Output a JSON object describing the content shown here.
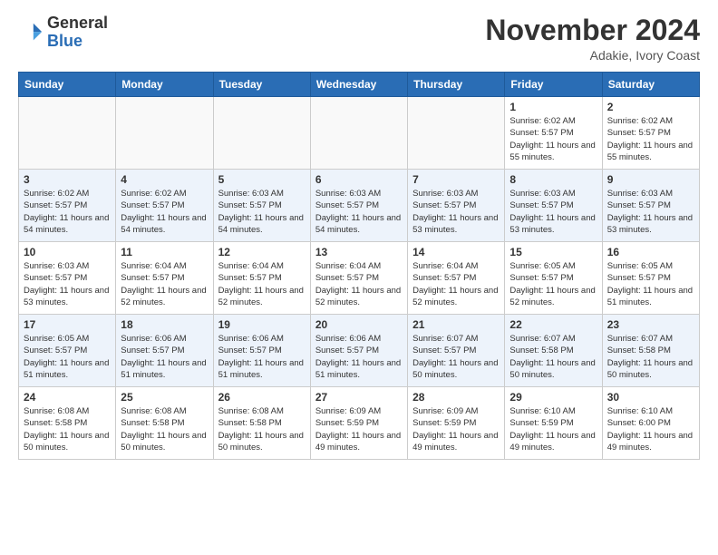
{
  "header": {
    "logo_general": "General",
    "logo_blue": "Blue",
    "month_title": "November 2024",
    "location": "Adakie, Ivory Coast"
  },
  "weekdays": [
    "Sunday",
    "Monday",
    "Tuesday",
    "Wednesday",
    "Thursday",
    "Friday",
    "Saturday"
  ],
  "weeks": [
    [
      {
        "day": "",
        "sunrise": "",
        "sunset": "",
        "daylight": ""
      },
      {
        "day": "",
        "sunrise": "",
        "sunset": "",
        "daylight": ""
      },
      {
        "day": "",
        "sunrise": "",
        "sunset": "",
        "daylight": ""
      },
      {
        "day": "",
        "sunrise": "",
        "sunset": "",
        "daylight": ""
      },
      {
        "day": "",
        "sunrise": "",
        "sunset": "",
        "daylight": ""
      },
      {
        "day": "1",
        "sunrise": "Sunrise: 6:02 AM",
        "sunset": "Sunset: 5:57 PM",
        "daylight": "Daylight: 11 hours and 55 minutes."
      },
      {
        "day": "2",
        "sunrise": "Sunrise: 6:02 AM",
        "sunset": "Sunset: 5:57 PM",
        "daylight": "Daylight: 11 hours and 55 minutes."
      }
    ],
    [
      {
        "day": "3",
        "sunrise": "Sunrise: 6:02 AM",
        "sunset": "Sunset: 5:57 PM",
        "daylight": "Daylight: 11 hours and 54 minutes."
      },
      {
        "day": "4",
        "sunrise": "Sunrise: 6:02 AM",
        "sunset": "Sunset: 5:57 PM",
        "daylight": "Daylight: 11 hours and 54 minutes."
      },
      {
        "day": "5",
        "sunrise": "Sunrise: 6:03 AM",
        "sunset": "Sunset: 5:57 PM",
        "daylight": "Daylight: 11 hours and 54 minutes."
      },
      {
        "day": "6",
        "sunrise": "Sunrise: 6:03 AM",
        "sunset": "Sunset: 5:57 PM",
        "daylight": "Daylight: 11 hours and 54 minutes."
      },
      {
        "day": "7",
        "sunrise": "Sunrise: 6:03 AM",
        "sunset": "Sunset: 5:57 PM",
        "daylight": "Daylight: 11 hours and 53 minutes."
      },
      {
        "day": "8",
        "sunrise": "Sunrise: 6:03 AM",
        "sunset": "Sunset: 5:57 PM",
        "daylight": "Daylight: 11 hours and 53 minutes."
      },
      {
        "day": "9",
        "sunrise": "Sunrise: 6:03 AM",
        "sunset": "Sunset: 5:57 PM",
        "daylight": "Daylight: 11 hours and 53 minutes."
      }
    ],
    [
      {
        "day": "10",
        "sunrise": "Sunrise: 6:03 AM",
        "sunset": "Sunset: 5:57 PM",
        "daylight": "Daylight: 11 hours and 53 minutes."
      },
      {
        "day": "11",
        "sunrise": "Sunrise: 6:04 AM",
        "sunset": "Sunset: 5:57 PM",
        "daylight": "Daylight: 11 hours and 52 minutes."
      },
      {
        "day": "12",
        "sunrise": "Sunrise: 6:04 AM",
        "sunset": "Sunset: 5:57 PM",
        "daylight": "Daylight: 11 hours and 52 minutes."
      },
      {
        "day": "13",
        "sunrise": "Sunrise: 6:04 AM",
        "sunset": "Sunset: 5:57 PM",
        "daylight": "Daylight: 11 hours and 52 minutes."
      },
      {
        "day": "14",
        "sunrise": "Sunrise: 6:04 AM",
        "sunset": "Sunset: 5:57 PM",
        "daylight": "Daylight: 11 hours and 52 minutes."
      },
      {
        "day": "15",
        "sunrise": "Sunrise: 6:05 AM",
        "sunset": "Sunset: 5:57 PM",
        "daylight": "Daylight: 11 hours and 52 minutes."
      },
      {
        "day": "16",
        "sunrise": "Sunrise: 6:05 AM",
        "sunset": "Sunset: 5:57 PM",
        "daylight": "Daylight: 11 hours and 51 minutes."
      }
    ],
    [
      {
        "day": "17",
        "sunrise": "Sunrise: 6:05 AM",
        "sunset": "Sunset: 5:57 PM",
        "daylight": "Daylight: 11 hours and 51 minutes."
      },
      {
        "day": "18",
        "sunrise": "Sunrise: 6:06 AM",
        "sunset": "Sunset: 5:57 PM",
        "daylight": "Daylight: 11 hours and 51 minutes."
      },
      {
        "day": "19",
        "sunrise": "Sunrise: 6:06 AM",
        "sunset": "Sunset: 5:57 PM",
        "daylight": "Daylight: 11 hours and 51 minutes."
      },
      {
        "day": "20",
        "sunrise": "Sunrise: 6:06 AM",
        "sunset": "Sunset: 5:57 PM",
        "daylight": "Daylight: 11 hours and 51 minutes."
      },
      {
        "day": "21",
        "sunrise": "Sunrise: 6:07 AM",
        "sunset": "Sunset: 5:57 PM",
        "daylight": "Daylight: 11 hours and 50 minutes."
      },
      {
        "day": "22",
        "sunrise": "Sunrise: 6:07 AM",
        "sunset": "Sunset: 5:58 PM",
        "daylight": "Daylight: 11 hours and 50 minutes."
      },
      {
        "day": "23",
        "sunrise": "Sunrise: 6:07 AM",
        "sunset": "Sunset: 5:58 PM",
        "daylight": "Daylight: 11 hours and 50 minutes."
      }
    ],
    [
      {
        "day": "24",
        "sunrise": "Sunrise: 6:08 AM",
        "sunset": "Sunset: 5:58 PM",
        "daylight": "Daylight: 11 hours and 50 minutes."
      },
      {
        "day": "25",
        "sunrise": "Sunrise: 6:08 AM",
        "sunset": "Sunset: 5:58 PM",
        "daylight": "Daylight: 11 hours and 50 minutes."
      },
      {
        "day": "26",
        "sunrise": "Sunrise: 6:08 AM",
        "sunset": "Sunset: 5:58 PM",
        "daylight": "Daylight: 11 hours and 50 minutes."
      },
      {
        "day": "27",
        "sunrise": "Sunrise: 6:09 AM",
        "sunset": "Sunset: 5:59 PM",
        "daylight": "Daylight: 11 hours and 49 minutes."
      },
      {
        "day": "28",
        "sunrise": "Sunrise: 6:09 AM",
        "sunset": "Sunset: 5:59 PM",
        "daylight": "Daylight: 11 hours and 49 minutes."
      },
      {
        "day": "29",
        "sunrise": "Sunrise: 6:10 AM",
        "sunset": "Sunset: 5:59 PM",
        "daylight": "Daylight: 11 hours and 49 minutes."
      },
      {
        "day": "30",
        "sunrise": "Sunrise: 6:10 AM",
        "sunset": "Sunset: 6:00 PM",
        "daylight": "Daylight: 11 hours and 49 minutes."
      }
    ]
  ]
}
